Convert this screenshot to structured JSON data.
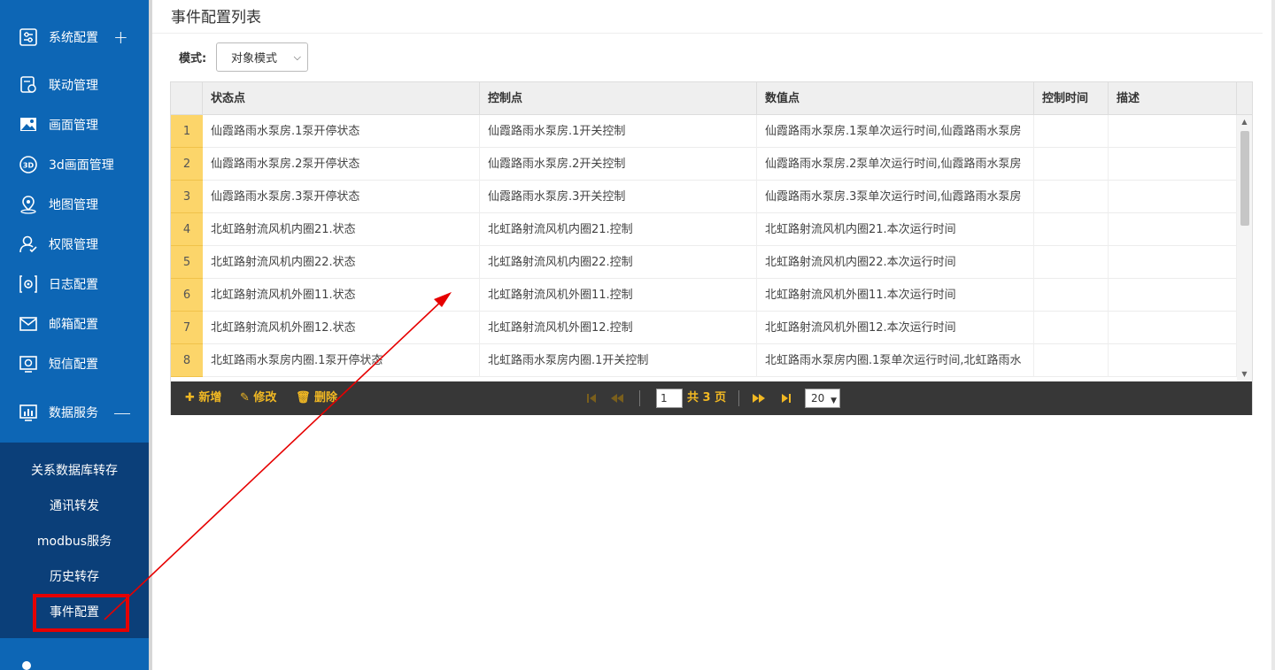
{
  "sidebar": {
    "items": [
      {
        "label": "系统配置",
        "icon": "settings-sliders-icon",
        "expander": "+"
      },
      {
        "label": "联动管理",
        "icon": "linkage-icon"
      },
      {
        "label": "画面管理",
        "icon": "picture-icon"
      },
      {
        "label": "3d画面管理",
        "icon": "3d-icon"
      },
      {
        "label": "地图管理",
        "icon": "map-pin-icon"
      },
      {
        "label": "权限管理",
        "icon": "user-permission-icon"
      },
      {
        "label": "日志配置",
        "icon": "log-gear-icon"
      },
      {
        "label": "邮箱配置",
        "icon": "mail-icon"
      },
      {
        "label": "短信配置",
        "icon": "sms-gear-icon"
      },
      {
        "label": "数据服务",
        "icon": "data-chart-icon",
        "expander": "—"
      }
    ],
    "subitems": [
      {
        "label": "关系数据库转存"
      },
      {
        "label": "通讯转发"
      },
      {
        "label": "modbus服务"
      },
      {
        "label": "历史转存"
      },
      {
        "label": "事件配置",
        "active": true
      }
    ]
  },
  "main": {
    "title": "事件配置列表",
    "mode_label": "模式:",
    "mode_value": "对象模式"
  },
  "grid": {
    "columns": [
      "状态点",
      "控制点",
      "数值点",
      "控制时间",
      "描述"
    ],
    "rows": [
      {
        "num": "1",
        "status": "仙霞路雨水泵房.1泵开停状态",
        "control": "仙霞路雨水泵房.1开关控制",
        "value": "仙霞路雨水泵房.1泵单次运行时间,仙霞路雨水泵房",
        "time": "",
        "desc": ""
      },
      {
        "num": "2",
        "status": "仙霞路雨水泵房.2泵开停状态",
        "control": "仙霞路雨水泵房.2开关控制",
        "value": "仙霞路雨水泵房.2泵单次运行时间,仙霞路雨水泵房",
        "time": "",
        "desc": ""
      },
      {
        "num": "3",
        "status": "仙霞路雨水泵房.3泵开停状态",
        "control": "仙霞路雨水泵房.3开关控制",
        "value": "仙霞路雨水泵房.3泵单次运行时间,仙霞路雨水泵房",
        "time": "",
        "desc": ""
      },
      {
        "num": "4",
        "status": "北虹路射流风机内圈21.状态",
        "control": "北虹路射流风机内圈21.控制",
        "value": "北虹路射流风机内圈21.本次运行时间",
        "time": "",
        "desc": ""
      },
      {
        "num": "5",
        "status": "北虹路射流风机内圈22.状态",
        "control": "北虹路射流风机内圈22.控制",
        "value": "北虹路射流风机内圈22.本次运行时间",
        "time": "",
        "desc": ""
      },
      {
        "num": "6",
        "status": "北虹路射流风机外圈11.状态",
        "control": "北虹路射流风机外圈11.控制",
        "value": "北虹路射流风机外圈11.本次运行时间",
        "time": "",
        "desc": ""
      },
      {
        "num": "7",
        "status": "北虹路射流风机外圈12.状态",
        "control": "北虹路射流风机外圈12.控制",
        "value": "北虹路射流风机外圈12.本次运行时间",
        "time": "",
        "desc": ""
      },
      {
        "num": "8",
        "status": "北虹路雨水泵房内圈.1泵开停状态",
        "control": "北虹路雨水泵房内圈.1开关控制",
        "value": "北虹路雨水泵房内圈.1泵单次运行时间,北虹路雨水",
        "time": "",
        "desc": ""
      }
    ]
  },
  "toolbar": {
    "add_label": "✚ 新增",
    "edit_label": "✎ 修改",
    "delete_label": "🗑 删除",
    "current_page": "1",
    "total_pages": "共 3 页",
    "page_size": "20"
  },
  "colors": {
    "sidebar_bg": "#0d66b5",
    "submenu_bg": "#0b3f79",
    "row_number_bg": "#fcd56a",
    "toolbar_bg": "#373737",
    "toolbar_text": "#f1b823",
    "annotation_red": "#e60000"
  }
}
